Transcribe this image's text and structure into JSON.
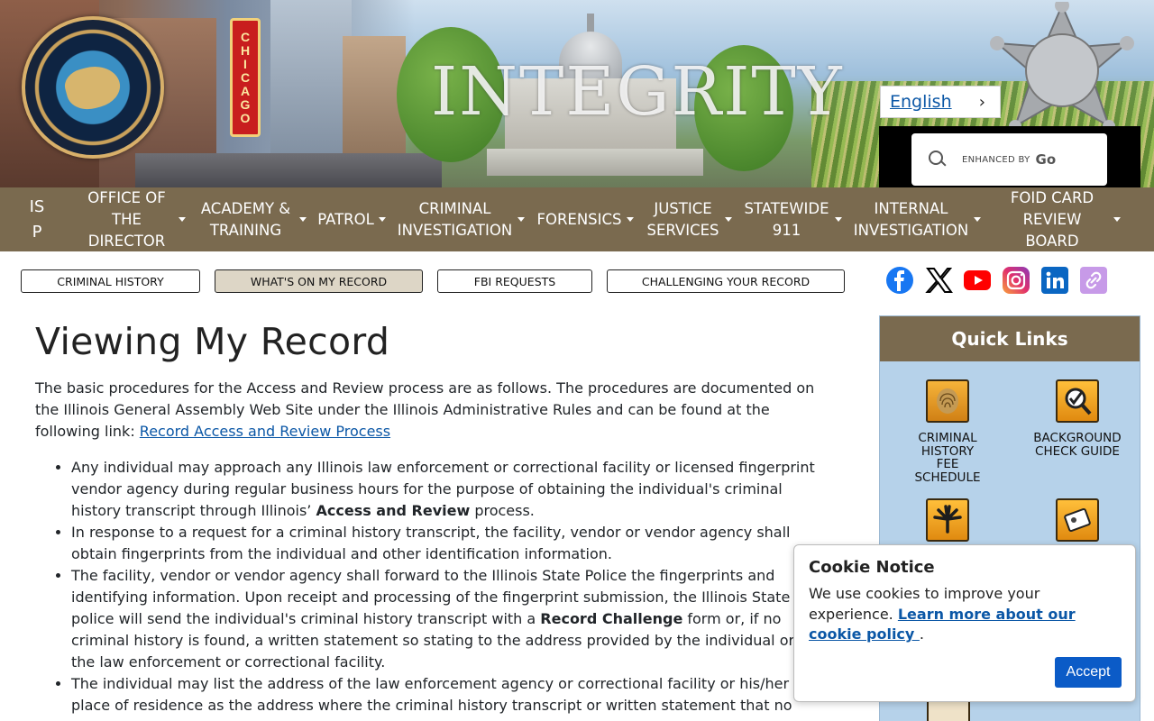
{
  "header": {
    "banner_word": "INTEGRITY",
    "chicago_sign": "CHICAGO",
    "language": "English",
    "search_brand": "ENHANCED BY",
    "search_go": "Go"
  },
  "nav": {
    "items": [
      {
        "label": "IS P"
      },
      {
        "label": "OFFICE OF THE DIRECTOR"
      },
      {
        "label": "ACADEMY & TRAINING"
      },
      {
        "label": "PATROL"
      },
      {
        "label": "CRIMINAL INVESTIGATION"
      },
      {
        "label": "FORENSICS"
      },
      {
        "label": "JUSTICE SERVICES"
      },
      {
        "label": "STATEWIDE 911"
      },
      {
        "label": "INTERNAL INVESTIGATION"
      },
      {
        "label": "FOID CARD REVIEW BOARD"
      }
    ]
  },
  "subtabs": [
    {
      "label": "CRIMINAL HISTORY"
    },
    {
      "label": "WHAT'S ON MY RECORD"
    },
    {
      "label": "FBI REQUESTS"
    },
    {
      "label": "CHALLENGING YOUR RECORD"
    }
  ],
  "social": [
    "facebook-icon",
    "x-icon",
    "youtube-icon",
    "instagram-icon",
    "linkedin-icon",
    "link-icon"
  ],
  "main": {
    "title": "Viewing My Record",
    "intro": "The basic procedures for the Access and Review process are as follows. The procedures are documented on the Illinois General Assembly Web Site under the Illinois Administrative Rules and can be found at the following link: ",
    "intro_link": "Record Access and Review Process",
    "bullets": [
      {
        "pre": "Any individual may approach any Illinois law enforcement or correctional facility or licensed fingerprint vendor agency during regular business hours for the purpose of obtaining the individual's criminal history transcript through Illinois’ ",
        "bold": "Access and Review",
        "post": " process."
      },
      {
        "pre": "In response to a request for a criminal history transcript, the facility, vendor or vendor agency shall obtain fingerprints from the individual and other identification information.",
        "bold": "",
        "post": ""
      },
      {
        "pre": "The facility, vendor or vendor agency shall forward to the Illinois State Police the fingerprints and identifying information. Upon receipt and processing of the fingerprint submission, the Illinois State police will send the individual's criminal history transcript with a ",
        "bold": "Record Challenge",
        "post": " form or, if no criminal history is found, a written statement so stating to the address provided by the individual or the law enforcement or correctional facility."
      },
      {
        "pre": "The individual may list the address of the law enforcement agency or correctional facility or his/her place of residence as the address where the criminal history transcript or written statement that no",
        "bold": "",
        "post": ""
      }
    ]
  },
  "quick_links": {
    "title": "Quick Links",
    "items": [
      {
        "label": "CRIMINAL HISTORY FEE SCHEDULE",
        "icon": "fingerprint-icon"
      },
      {
        "label": "BACKGROUND CHECK GUIDE",
        "icon": "magnifier-check-icon"
      },
      {
        "label": "",
        "icon": "cannabis-leaf-icon"
      },
      {
        "label": "",
        "icon": "id-card-icon"
      }
    ]
  },
  "cookie": {
    "title": "Cookie Notice",
    "text": "We use cookies to improve your experience. ",
    "link": "Learn more about our cookie policy ",
    "period": ".",
    "accept": "Accept"
  }
}
